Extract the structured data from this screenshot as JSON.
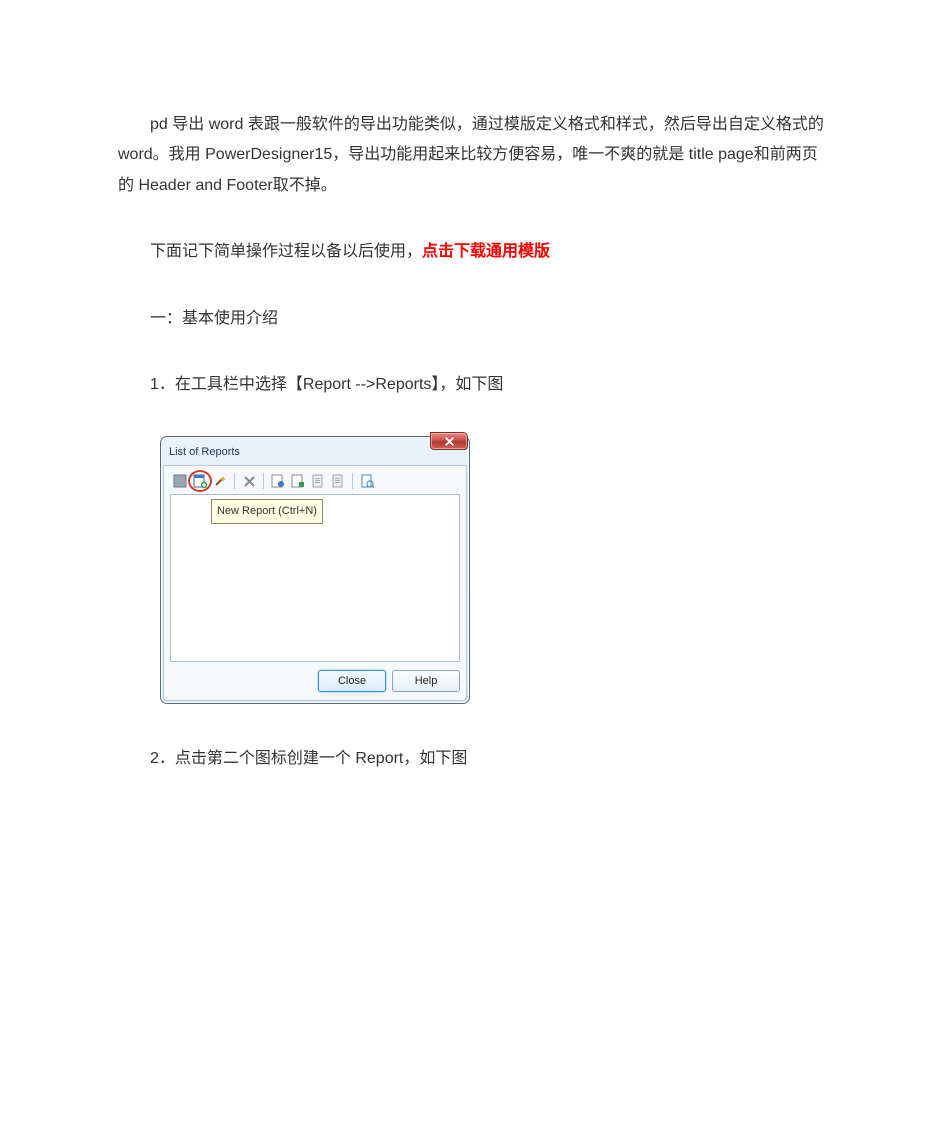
{
  "para1": "pd 导出 word 表跟一般软件的导出功能类似，通过模版定义格式和样式，然后导出自定义格式的 word。我用 PowerDesigner15，导出功能用起来比较方便容易，唯一不爽的就是 title  page和前两页的 Header  and  Footer取不掉。",
  "para2_prefix": "下面记下简单操作过程以备以后使用，",
  "para2_link": "点击下载通用模版",
  "section_heading": "一：基本使用介绍",
  "step1": "1．在工具栏中选择【Report  -->Reports】，如下图",
  "step2": "2．点击第二个图标创建一个 Report，如下图",
  "dialog": {
    "title": "List of Reports",
    "tooltip": "New Report (Ctrl+N)",
    "close_button": "Close",
    "help_button": "Help",
    "close_x_label": "Close"
  },
  "icons": {
    "props": "properties-icon",
    "new": "new-report-icon",
    "wizard": "wizard-icon",
    "delete": "delete-icon",
    "gen_html": "generate-html-icon",
    "gen_rtf": "generate-rtf-icon",
    "doc1": "document-icon",
    "doc2": "document-icon-2",
    "preview": "print-preview-icon"
  }
}
